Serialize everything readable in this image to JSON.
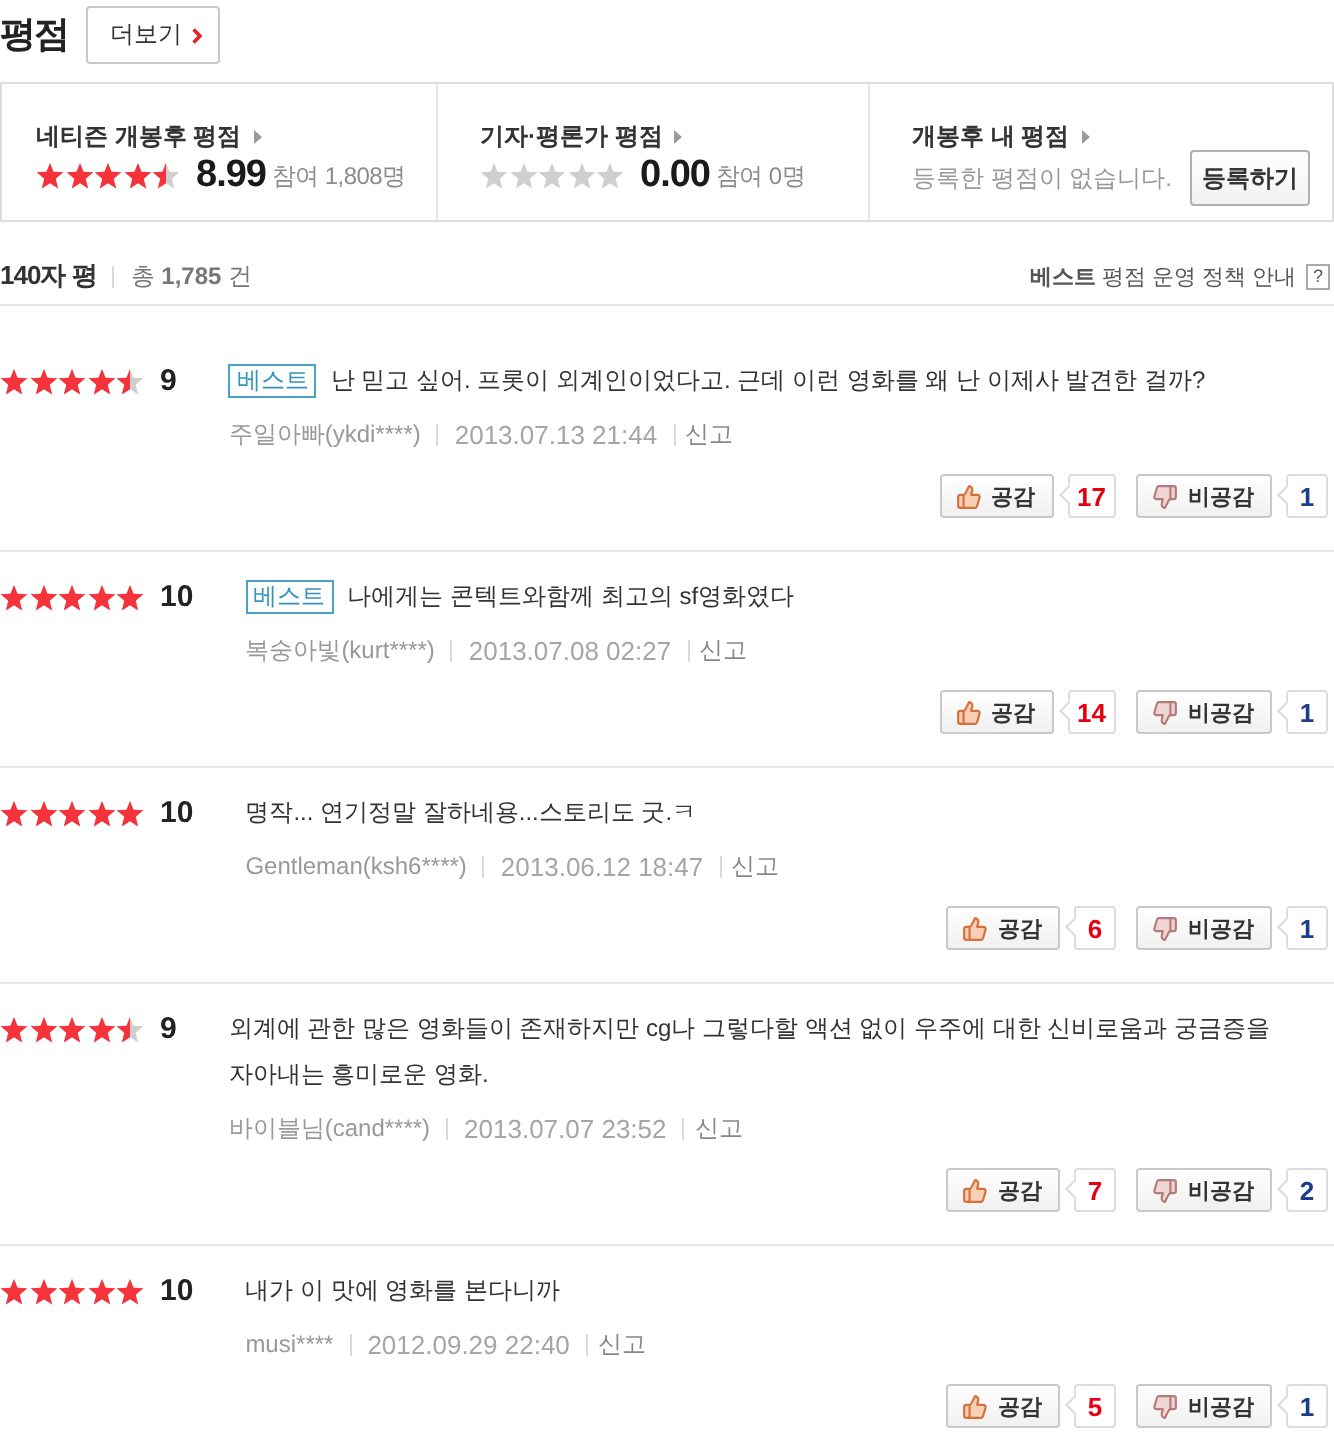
{
  "header": {
    "title": "평점",
    "more_button": "더보기"
  },
  "summary": [
    {
      "kind": "rating",
      "title": "네티즌 개봉후 평점",
      "stars": 4.5,
      "score": "8.99",
      "participation": "참여 1,808명"
    },
    {
      "kind": "rating",
      "title": "기자·평론가 평점",
      "stars": 0,
      "score": "0.00",
      "participation": "참여 0명"
    },
    {
      "kind": "mine",
      "title": "개봉후 내 평점",
      "message": "등록한 평점이 없습니다.",
      "button": "등록하기"
    }
  ],
  "list_header": {
    "title": "140자 평",
    "total": "총 **1,785** 건",
    "policy_link": "**베스트** 평점 운영 정책 안내",
    "help_button": "?"
  },
  "reviews": [
    {
      "stars": 4.5,
      "score": "9",
      "badge": "베스트",
      "text": "난 믿고 싶어. 프롯이 외계인이었다고. 근데 이런 영화를 왜 난 이제사 발견한 걸까?",
      "author": "주일아빠(ykdi****)",
      "date": "2013.07.13 21:44",
      "report": "신고",
      "like_label": "공감",
      "likes": "17",
      "dislike_label": "비공감",
      "dislikes": "1"
    },
    {
      "stars": 5,
      "score": "10",
      "badge": "베스트",
      "text": "나에게는 콘텍트와함께 최고의 sf영화였다",
      "author": "복숭아빛(kurt****)",
      "date": "2013.07.08 02:27",
      "report": "신고",
      "like_label": "공감",
      "likes": "14",
      "dislike_label": "비공감",
      "dislikes": "1"
    },
    {
      "stars": 5,
      "score": "10",
      "text": "명작... 연기정말 잘하네용...스토리도 굿.ㅋ",
      "author": "Gentleman(ksh6****)",
      "date": "2013.06.12 18:47",
      "report": "신고",
      "like_label": "공감",
      "likes": "6",
      "dislike_label": "비공감",
      "dislikes": "1"
    },
    {
      "stars": 4.5,
      "score": "9",
      "text": "외계에 관한 많은 영화들이 존재하지만 cg나 그렇다할 액션 없이 우주에 대한 신비로움과 궁금증을 자아내는 흥미로운 영화.",
      "author": "바이블님(cand****)",
      "date": "2013.07.07 23:52",
      "report": "신고",
      "like_label": "공감",
      "likes": "7",
      "dislike_label": "비공감",
      "dislikes": "2"
    },
    {
      "stars": 5,
      "score": "10",
      "text": "내가 이 맛에 영화를 본다니까",
      "author": "musi****",
      "date": "2012.09.29 22:40",
      "report": "신고",
      "like_label": "공감",
      "likes": "5",
      "dislike_label": "비공감",
      "dislikes": "1"
    }
  ]
}
